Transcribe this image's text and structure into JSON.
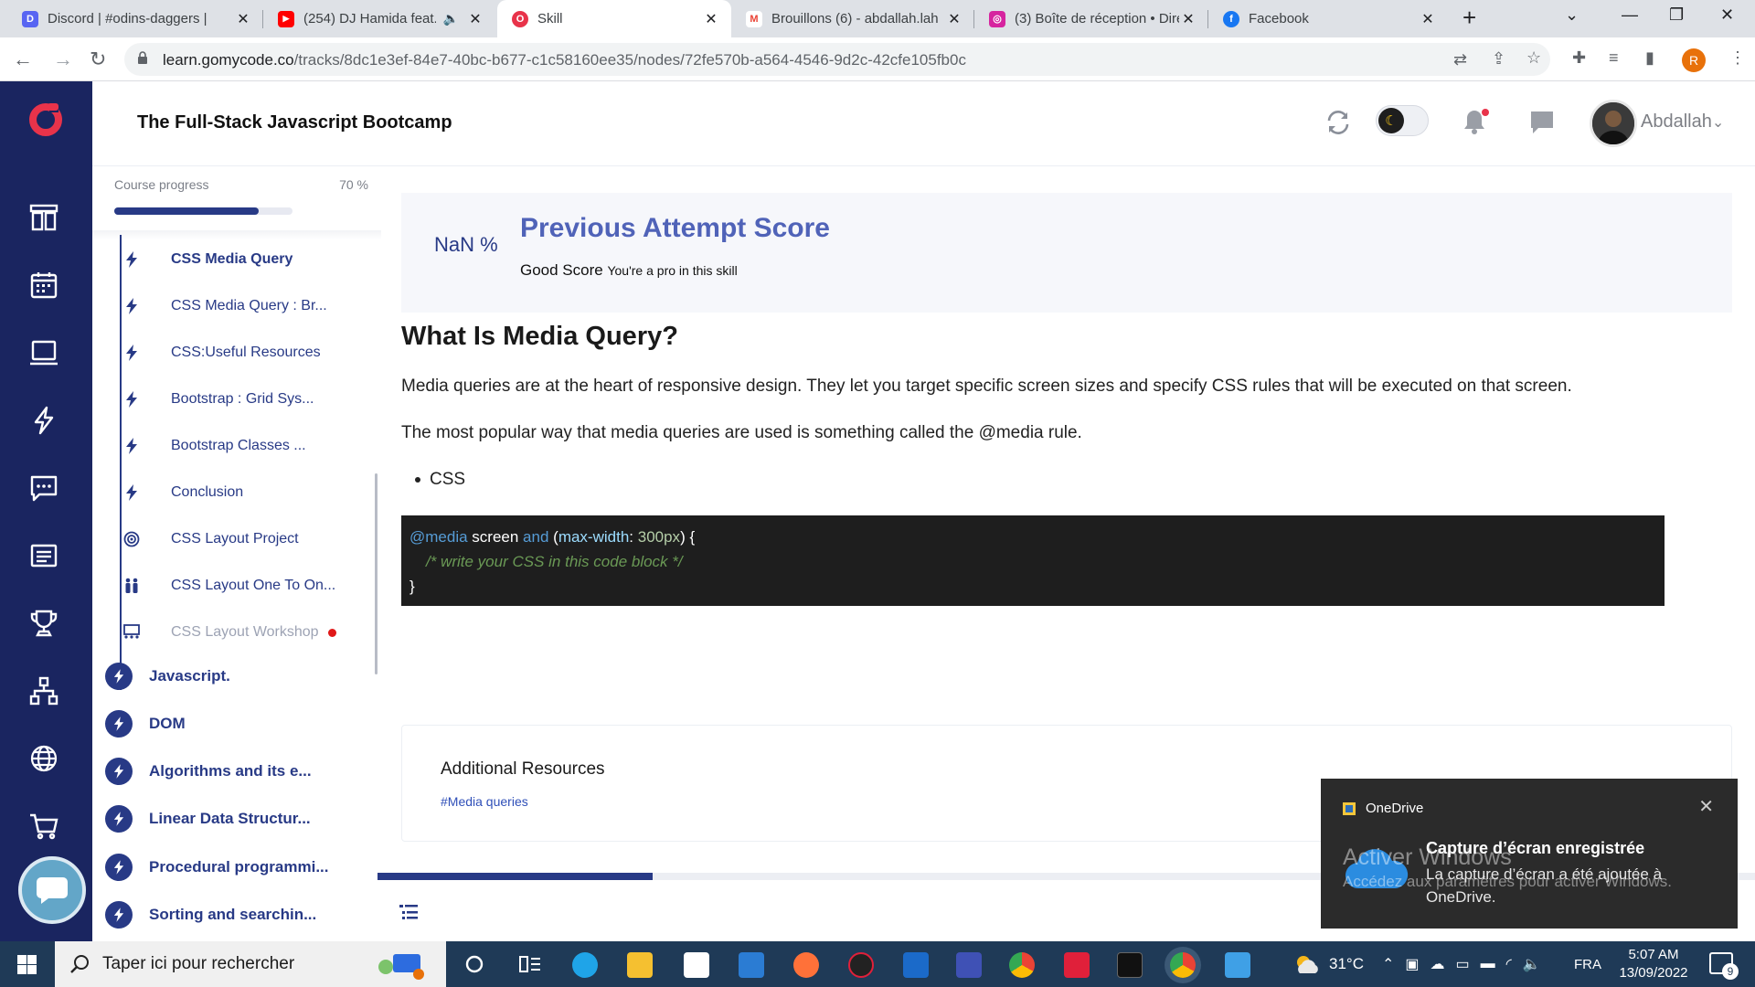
{
  "browser": {
    "tabs": [
      {
        "title": "Discord | #odins-daggers | ",
        "fav_color": "#5865f2",
        "fav_glyph": "D"
      },
      {
        "title": "(254) DJ Hamida feat. A",
        "fav_color": "#ff0000",
        "fav_glyph": "▶"
      },
      {
        "title": "Skill",
        "fav_color": "#e8334a",
        "fav_glyph": "O"
      },
      {
        "title": "Brouillons (6) - abdallah.lah",
        "fav_color": "#ea4335",
        "fav_glyph": "M"
      },
      {
        "title": "(3) Boîte de réception • Dire",
        "fav_color": "#d6249f",
        "fav_glyph": "◎"
      },
      {
        "title": "Facebook",
        "fav_color": "#1877f2",
        "fav_glyph": "f"
      }
    ],
    "url_host": "learn.gomycode.co",
    "url_path": "/tracks/8dc1e3ef-84e7-40bc-b677-c1c58160ee35/nodes/72fe570b-a564-4546-9d2c-42cfe105fb0c",
    "profile_initial": "R"
  },
  "header": {
    "title": "The Full-Stack Javascript Bootcamp",
    "username": "Abdallah",
    "chevron": "⌄"
  },
  "sidebar": {
    "progress_label": "Course progress",
    "progress_value": "70 %",
    "progress_fraction": 0.7,
    "sub_items": [
      {
        "label": "CSS Media Query",
        "icon": "bolt-icon",
        "state": "current"
      },
      {
        "label": "CSS Media Query : Br...",
        "icon": "bolt-icon",
        "state": "normal"
      },
      {
        "label": "CSS:Useful Resources",
        "icon": "bolt-icon",
        "state": "normal"
      },
      {
        "label": "Bootstrap : Grid Sys...",
        "icon": "bolt-icon",
        "state": "normal"
      },
      {
        "label": "Bootstrap Classes ...",
        "icon": "bolt-icon",
        "state": "normal"
      },
      {
        "label": "Conclusion",
        "icon": "bolt-icon",
        "state": "normal"
      },
      {
        "label": "CSS Layout Project",
        "icon": "target-icon",
        "state": "normal"
      },
      {
        "label": "CSS Layout One To On...",
        "icon": "people-icon",
        "state": "normal"
      },
      {
        "label": "CSS Layout Workshop",
        "icon": "workshop-icon",
        "state": "locked"
      }
    ],
    "chapters": [
      {
        "label": "Javascript."
      },
      {
        "label": "DOM"
      },
      {
        "label": "Algorithms and its e..."
      },
      {
        "label": "Linear Data Structur..."
      },
      {
        "label": "Procedural programmi..."
      },
      {
        "label": "Sorting and searchin..."
      }
    ]
  },
  "main": {
    "score_value": "NaN %",
    "score_title": "Previous Attempt Score",
    "score_grade": "Good Score",
    "score_note": "You're a pro in this skill",
    "heading": "What Is Media Query?",
    "paragraph1": "Media queries are at the heart of responsive design. They let you target specific screen sizes and specify CSS rules that will be executed on that screen.",
    "paragraph2": "The most popular way that media queries are used is something called the @media rule.",
    "bullet": "CSS",
    "code": {
      "at": "@media",
      "screen": " screen ",
      "and": "and",
      "open": " (",
      "prop": "max-width",
      "colon": ": ",
      "val": "300px",
      "close": ") {",
      "comment": "/* write your CSS in this code block */",
      "end": "}"
    },
    "resources_title": "Additional Resources",
    "resources_link": "#Media queries",
    "lesson_progress_fraction": 0.2
  },
  "toast": {
    "app": "OneDrive",
    "close": "✕",
    "title": "Capture d’écran enregistrée",
    "body": "La capture d’écran a été ajoutée à OneDrive."
  },
  "watermark": {
    "line1": "Activer Windows",
    "line2": "Accédez aux paramètres pour activer Windows."
  },
  "taskbar": {
    "search_placeholder": "Taper ici pour rechercher",
    "temperature": "31°C",
    "language": "FRA",
    "time": "5:07 AM",
    "date": "13/09/2022",
    "notif_count": "9"
  },
  "colors": {
    "navy": "#1a2560",
    "accent": "#283a86",
    "score_title": "#5063b8"
  }
}
